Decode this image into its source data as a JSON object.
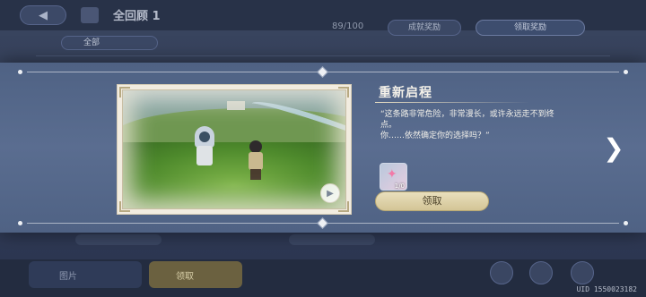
{
  "background": {
    "title": "全回顾 1",
    "filter_label": "全部",
    "progress_count": "89/100",
    "button_left": "成就奖励",
    "button_right": "领取奖励",
    "bottom_left_label": "图片",
    "bottom_mid_label": "领取",
    "uid": "UID 1550023182"
  },
  "modal": {
    "title": "重新启程",
    "description": [
      "“这条路非常危险，非常漫长，或许永远走不到终点。",
      "你……依然确定你的选择吗？”"
    ],
    "reward": {
      "icon": "star-ticket-icon",
      "quantity": "1/0"
    },
    "claim_label": "领取",
    "play_icon": "▶",
    "next_icon": "❯"
  },
  "colors": {
    "band": "#55688a",
    "claim_button": "#e3d7ae",
    "frame": "#f2ece0"
  }
}
